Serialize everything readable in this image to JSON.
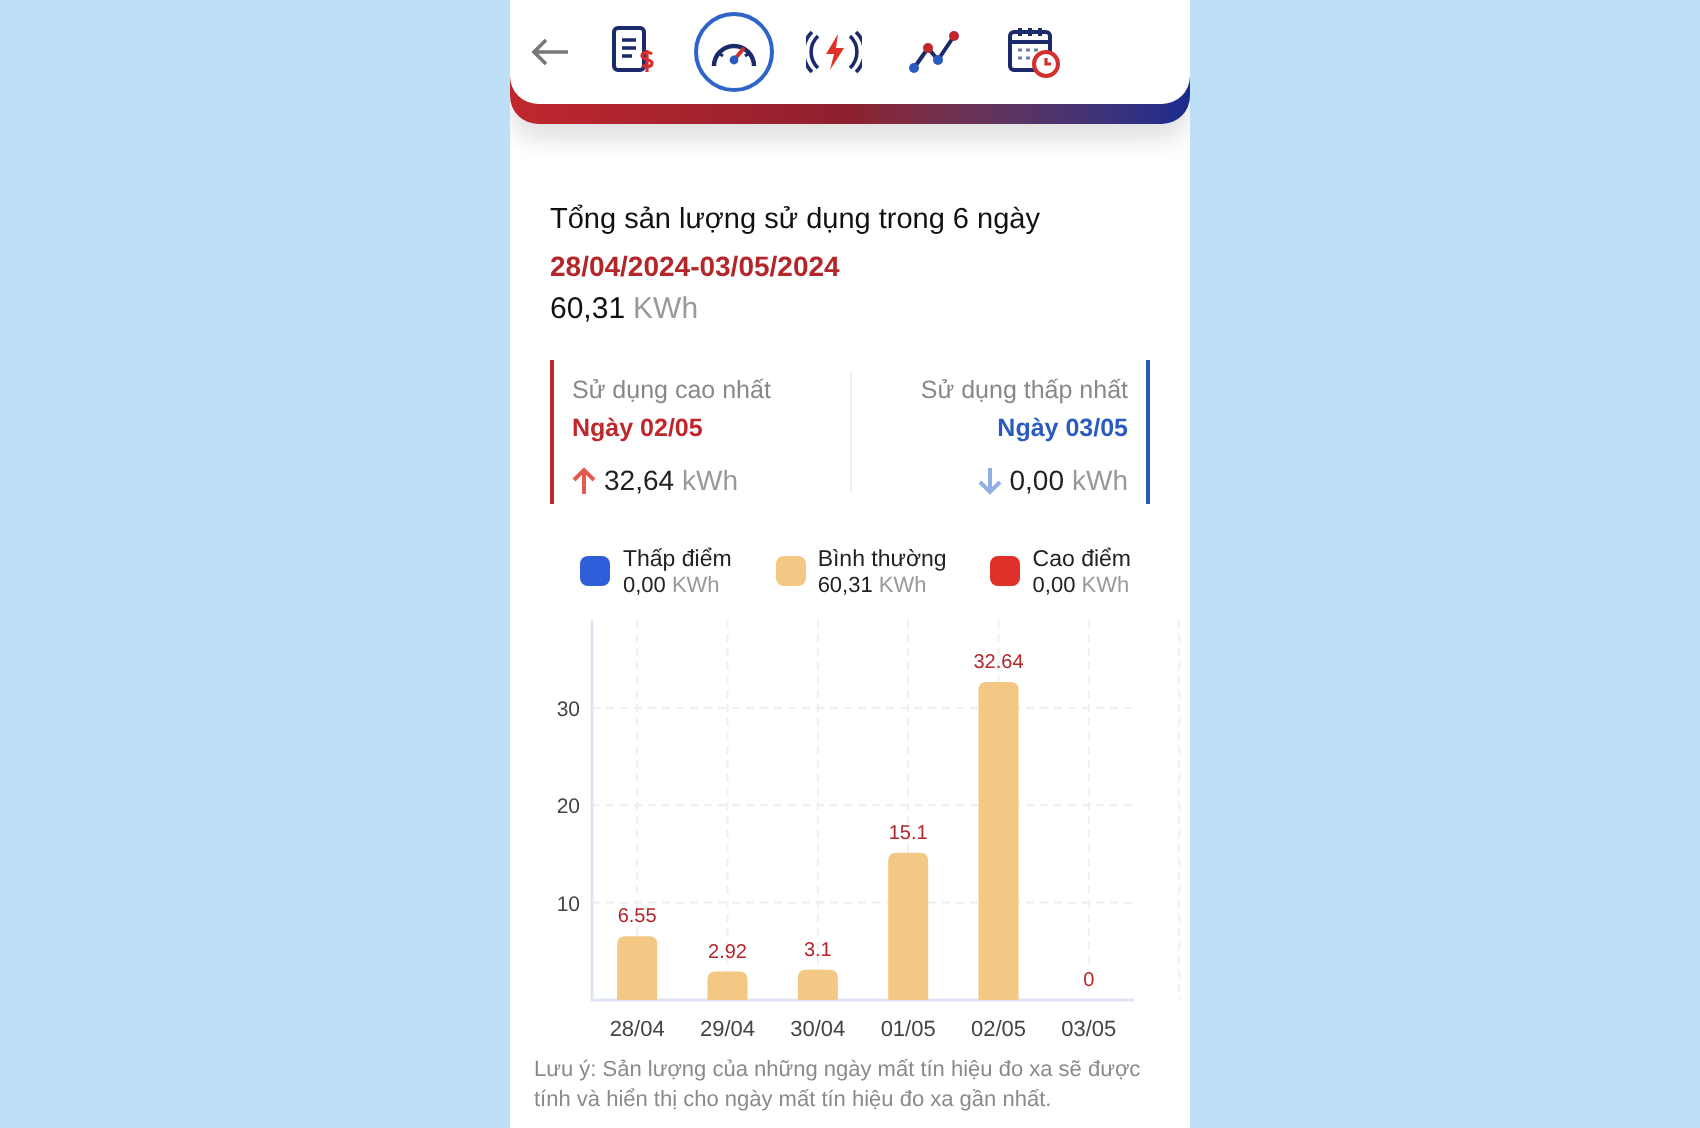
{
  "nav": {
    "tabs": [
      {
        "kind": "bill",
        "selected": false
      },
      {
        "kind": "gauge",
        "selected": true
      },
      {
        "kind": "signal",
        "selected": false
      },
      {
        "kind": "trend",
        "selected": false
      },
      {
        "kind": "calendar",
        "selected": false
      }
    ]
  },
  "summary": {
    "title": "Tổng sản lượng sử dụng trong 6 ngày",
    "period": "28/04/2024-03/05/2024",
    "total": "60,31",
    "total_unit": "KWh"
  },
  "highest": {
    "label": "Sử dụng cao nhất",
    "day": "Ngày 02/05",
    "value": "32,64",
    "unit": "kWh"
  },
  "lowest": {
    "label": "Sử dụng thấp nhất",
    "day": "Ngày 03/05",
    "value": "0,00",
    "unit": "kWh"
  },
  "legend": [
    {
      "name": "Thấp điểm",
      "value": "0,00",
      "unit": "KWh",
      "color": "#2f5fd8"
    },
    {
      "name": "Bình thường",
      "value": "60,31",
      "unit": "KWh",
      "color": "#f2c884"
    },
    {
      "name": "Cao điểm",
      "value": "0,00",
      "unit": "KWh",
      "color": "#e0302a"
    }
  ],
  "chart_data": {
    "type": "bar",
    "categories": [
      "28/04",
      "29/04",
      "30/04",
      "01/05",
      "02/05",
      "03/05"
    ],
    "series": [
      {
        "color": "#f2c884",
        "values": [
          6.55,
          2.92,
          3.1,
          15.1,
          32.64,
          0
        ]
      }
    ],
    "ylim": [
      0,
      39
    ],
    "yticks": [
      10,
      20,
      30
    ],
    "data_labels": true,
    "grid": true
  },
  "note": "Lưu ý: Sản lượng của những ngày mất tín hiệu đo xa sẽ được tính và hiển thị cho ngày mất tín hiệu đo xa gần nhất."
}
